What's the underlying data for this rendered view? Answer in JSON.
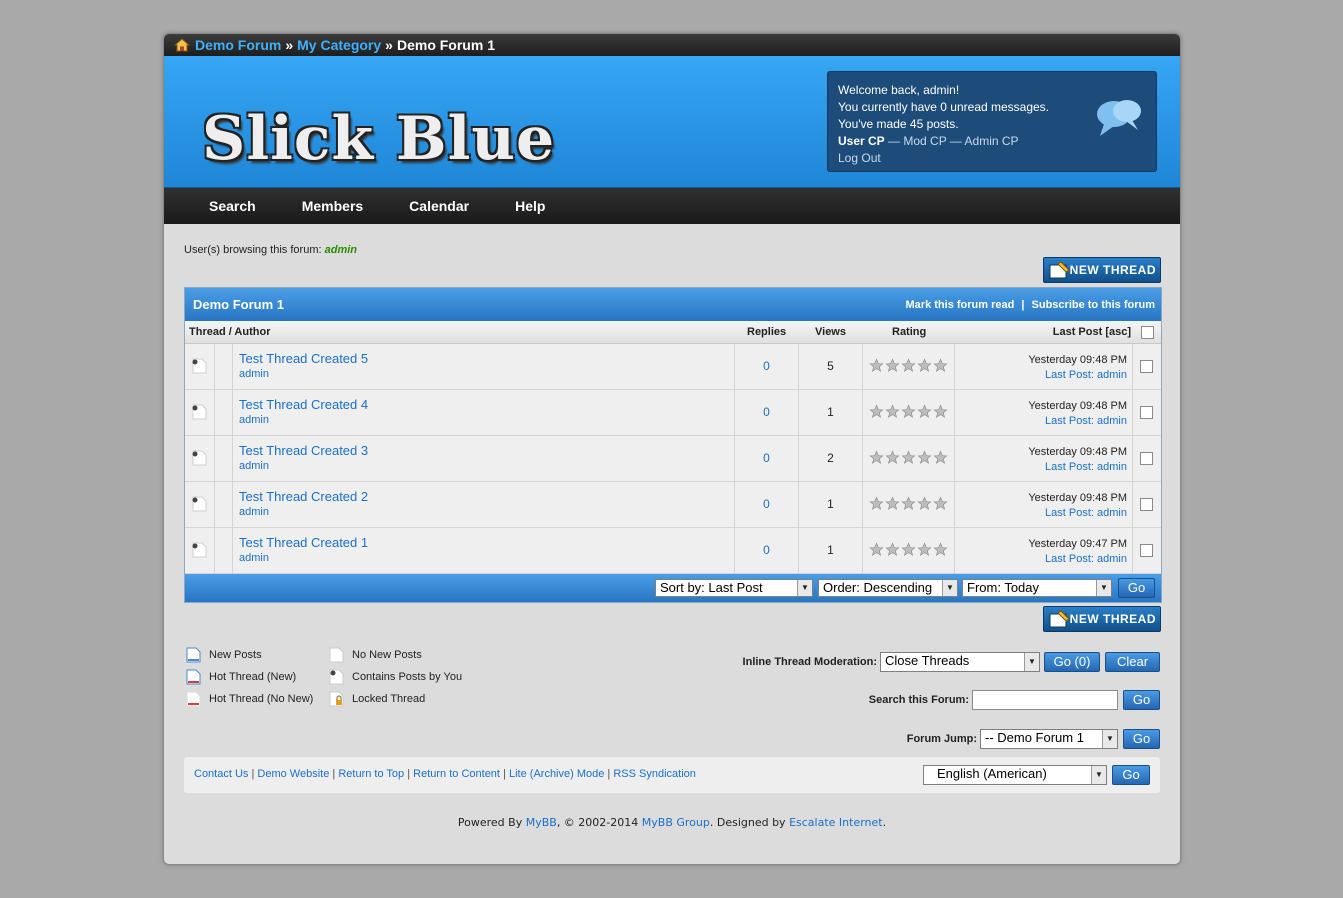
{
  "breadcrumb": {
    "home": "Demo Forum",
    "category": "My Category",
    "current": "Demo Forum 1",
    "sep": "»"
  },
  "logo": "Slick Blue",
  "welcome": {
    "line1": "Welcome back, admin!",
    "line2": "You currently have 0 unread messages.",
    "line3": "You've made 45 posts.",
    "usercp": "User CP",
    "dash": "—",
    "modcp": "Mod CP",
    "admincp": "Admin CP",
    "logout": "Log Out"
  },
  "nav": [
    "Search",
    "Members",
    "Calendar",
    "Help"
  ],
  "browsing": {
    "label": "User(s) browsing this forum:",
    "user": "admin"
  },
  "new_thread_label": "NEW THREAD",
  "forum": {
    "title": "Demo Forum 1",
    "mark_read": "Mark this forum read",
    "bar": "|",
    "subscribe": "Subscribe to this forum",
    "columns": {
      "thread": "Thread / Author",
      "replies": "Replies",
      "views": "Views",
      "rating": "Rating",
      "lastpost": "Last Post [asc]"
    },
    "threads": [
      {
        "title": "Test Thread Created 5",
        "author": "admin",
        "replies": "0",
        "views": "5",
        "date": "Yesterday 09:48 PM",
        "lp_label": "Last Post:",
        "lp_user": "admin"
      },
      {
        "title": "Test Thread Created 4",
        "author": "admin",
        "replies": "0",
        "views": "1",
        "date": "Yesterday 09:48 PM",
        "lp_label": "Last Post:",
        "lp_user": "admin"
      },
      {
        "title": "Test Thread Created 3",
        "author": "admin",
        "replies": "0",
        "views": "2",
        "date": "Yesterday 09:48 PM",
        "lp_label": "Last Post:",
        "lp_user": "admin"
      },
      {
        "title": "Test Thread Created 2",
        "author": "admin",
        "replies": "0",
        "views": "1",
        "date": "Yesterday 09:48 PM",
        "lp_label": "Last Post:",
        "lp_user": "admin"
      },
      {
        "title": "Test Thread Created 1",
        "author": "admin",
        "replies": "0",
        "views": "1",
        "date": "Yesterday 09:47 PM",
        "lp_label": "Last Post:",
        "lp_user": "admin"
      }
    ],
    "sort": {
      "sortby": "Sort by: Last Post",
      "order": "Order: Descending",
      "from": "From: Today",
      "go": "Go"
    }
  },
  "legend": {
    "new_posts": "New Posts",
    "hot_new": "Hot Thread (New)",
    "hot_nonew": "Hot Thread (No New)",
    "no_new": "No New Posts",
    "contains": "Contains Posts by You",
    "locked": "Locked Thread"
  },
  "moderation": {
    "label": "Inline Thread Moderation:",
    "selected": "Close Threads",
    "go": "Go (0)",
    "clear": "Clear"
  },
  "search_forum": {
    "label": "Search this Forum:",
    "go": "Go"
  },
  "jump": {
    "label": "Forum Jump:",
    "selected": "-- Demo Forum 1",
    "go": "Go"
  },
  "footer": {
    "links": [
      "Contact Us",
      "Demo Website",
      "Return to Top",
      "Return to Content",
      "Lite (Archive) Mode",
      "RSS Syndication"
    ],
    "sep": "|",
    "language": "English (American)",
    "go": "Go"
  },
  "powered": {
    "p1": "Powered By ",
    "mybb": "MyBB",
    "p2": ", © 2002-2014 ",
    "group": "MyBB Group",
    "p3": ". Designed by ",
    "designer": "Escalate Internet",
    "p4": "."
  },
  "colors": {
    "accent": "#2776c3",
    "link": "#1a70c8",
    "header": "#36a6f5",
    "navbar": "#1a1a1a"
  }
}
